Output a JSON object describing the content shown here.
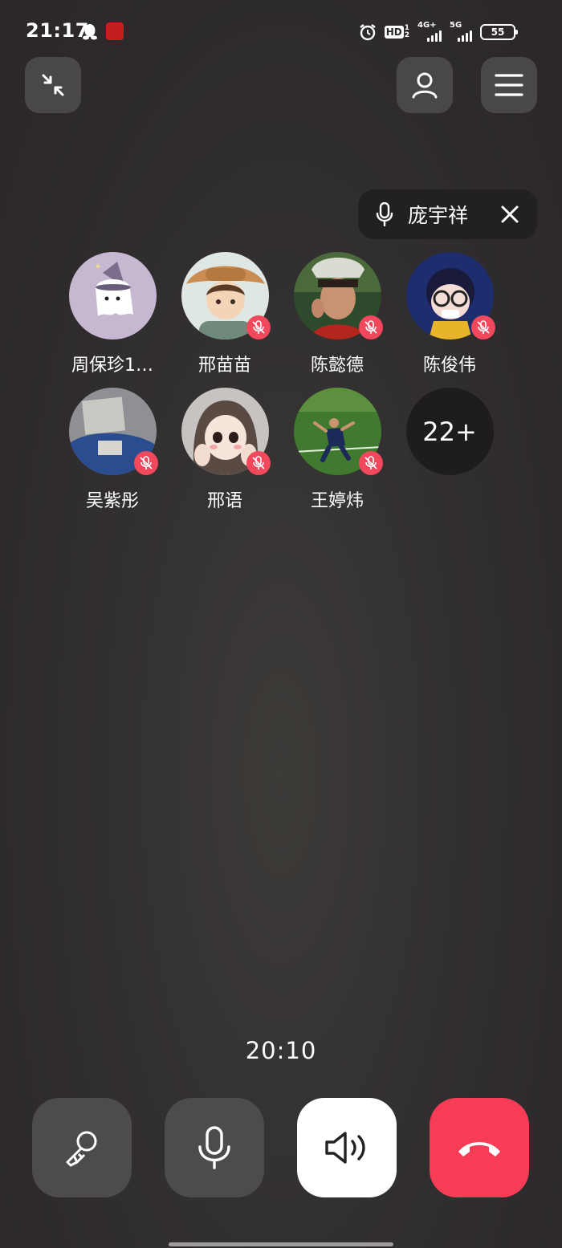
{
  "status_bar": {
    "time": "21:17",
    "hd_label": "HD",
    "hd_sub_top": "1",
    "hd_sub_bottom": "2",
    "network_1": "4G+",
    "network_2": "5G",
    "battery": "55"
  },
  "speaking": {
    "name": "庞宇祥"
  },
  "participants": [
    {
      "name": "周保珍1…",
      "muted": false
    },
    {
      "name": "邢苗苗",
      "muted": true
    },
    {
      "name": "陈懿德",
      "muted": true
    },
    {
      "name": "陈俊伟",
      "muted": true
    },
    {
      "name": "吴紫彤",
      "muted": true
    },
    {
      "name": "邢语",
      "muted": true
    },
    {
      "name": "王婷炜",
      "muted": true
    }
  ],
  "more_count": "22+",
  "call": {
    "duration": "20:10"
  },
  "colors": {
    "hangup": "#f73c55",
    "mute_badge": "#f2485c",
    "button_bg": "#4e4b4d",
    "background": "#2e2b2d"
  },
  "icons": {
    "minimize": "minimize-icon",
    "profile": "person-icon",
    "menu": "menu-icon",
    "effects": "effects-icon",
    "mic": "microphone-icon",
    "speaker": "speaker-icon",
    "hangup": "hang-up-icon"
  }
}
